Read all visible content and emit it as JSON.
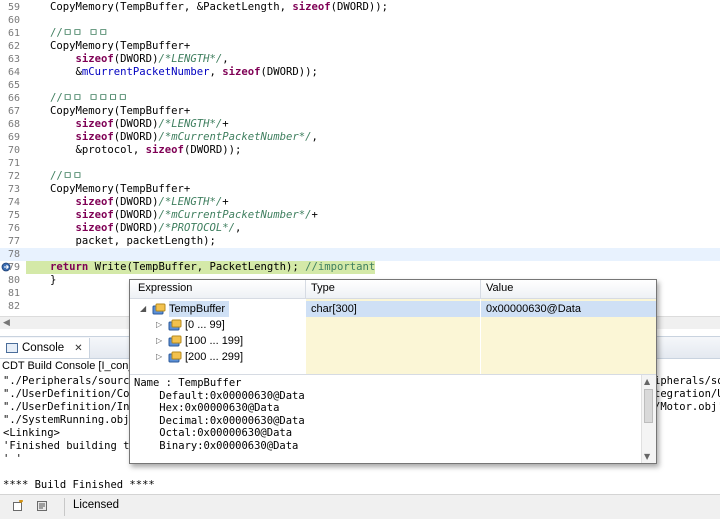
{
  "editor": {
    "lines": [
      {
        "num": "59",
        "tokens": [
          {
            "t": "CopyMemory(TempBuffer, &PacketLength, "
          },
          {
            "t": "sizeof",
            "c": "kw"
          },
          {
            "t": "(DWORD));"
          }
        ]
      },
      {
        "num": "60",
        "tokens": []
      },
      {
        "num": "61",
        "tokens": [
          {
            "t": "//ㅁㅁ ㅁㅁ",
            "c": "cm"
          }
        ]
      },
      {
        "num": "62",
        "tokens": [
          {
            "t": "CopyMemory(TempBuffer+"
          }
        ]
      },
      {
        "num": "63",
        "tokens": [
          {
            "t": "    "
          },
          {
            "t": "sizeof",
            "c": "kw"
          },
          {
            "t": "(DWORD)"
          },
          {
            "t": "/*LENGTH*/",
            "c": "cmi"
          },
          {
            "t": ","
          }
        ]
      },
      {
        "num": "64",
        "tokens": [
          {
            "t": "    &"
          },
          {
            "t": "mCurrentPacketNumber",
            "c": "mc"
          },
          {
            "t": ", "
          },
          {
            "t": "sizeof",
            "c": "kw"
          },
          {
            "t": "(DWORD));"
          }
        ]
      },
      {
        "num": "65",
        "tokens": []
      },
      {
        "num": "66",
        "tokens": [
          {
            "t": "//ㅁㅁ ㅁㅁㅁㅁ",
            "c": "cm"
          }
        ]
      },
      {
        "num": "67",
        "tokens": [
          {
            "t": "CopyMemory(TempBuffer+"
          }
        ]
      },
      {
        "num": "68",
        "tokens": [
          {
            "t": "    "
          },
          {
            "t": "sizeof",
            "c": "kw"
          },
          {
            "t": "(DWORD)"
          },
          {
            "t": "/*LENGTH*/",
            "c": "cmi"
          },
          {
            "t": "+"
          }
        ]
      },
      {
        "num": "69",
        "tokens": [
          {
            "t": "    "
          },
          {
            "t": "sizeof",
            "c": "kw"
          },
          {
            "t": "(DWORD)"
          },
          {
            "t": "/*mCurrentPacketNumber*/",
            "c": "cmi"
          },
          {
            "t": ","
          }
        ]
      },
      {
        "num": "70",
        "tokens": [
          {
            "t": "    &protocol, "
          },
          {
            "t": "sizeof",
            "c": "kw"
          },
          {
            "t": "(DWORD));"
          }
        ]
      },
      {
        "num": "71",
        "tokens": []
      },
      {
        "num": "72",
        "tokens": [
          {
            "t": "//ㅁㅁ",
            "c": "cm"
          }
        ]
      },
      {
        "num": "73",
        "tokens": [
          {
            "t": "CopyMemory(TempBuffer+"
          }
        ]
      },
      {
        "num": "74",
        "tokens": [
          {
            "t": "    "
          },
          {
            "t": "sizeof",
            "c": "kw"
          },
          {
            "t": "(DWORD)"
          },
          {
            "t": "/*LENGTH*/",
            "c": "cmi"
          },
          {
            "t": "+"
          }
        ]
      },
      {
        "num": "75",
        "tokens": [
          {
            "t": "    "
          },
          {
            "t": "sizeof",
            "c": "kw"
          },
          {
            "t": "(DWORD)"
          },
          {
            "t": "/*mCurrentPacketNumber*/",
            "c": "cmi"
          },
          {
            "t": "+"
          }
        ]
      },
      {
        "num": "76",
        "tokens": [
          {
            "t": "    "
          },
          {
            "t": "sizeof",
            "c": "kw"
          },
          {
            "t": "(DWORD)"
          },
          {
            "t": "/*PROTOCOL*/",
            "c": "cmi"
          },
          {
            "t": ","
          }
        ]
      },
      {
        "num": "77",
        "tokens": [
          {
            "t": "    packet, packetLength);"
          }
        ]
      },
      {
        "num": "78",
        "tokens": [],
        "current": true
      },
      {
        "num": "79",
        "tokens": [
          {
            "t": "return",
            "c": "kw"
          },
          {
            "t": " Write(TempBuffer, PacketLength); "
          },
          {
            "t": "//important",
            "c": "cm"
          }
        ],
        "highlight": true
      },
      {
        "num": "80",
        "tokens": [
          {
            "t": "}"
          }
        ]
      },
      {
        "num": "81",
        "tokens": []
      },
      {
        "num": "82",
        "tokens": []
      }
    ]
  },
  "console": {
    "tab_label": "Console",
    "close_glyph": "✕",
    "subtitle": "CDT Build Console [I_con_c",
    "lines": [
      "\"./Peripherals/source",
      "\"./UserDefinition/Con",
      "\"./UserDefinition/Int",
      "\"./SystemRunning.obj\"",
      "<Linking>",
      "'Finished building ta",
      "' '",
      "",
      "**** Build Finished ****"
    ],
    "right_lines": [
      "ipherals/so",
      "tegration/U",
      "/Motor.obj'"
    ]
  },
  "statusbar": {
    "label": "Licensed"
  },
  "expression_popup": {
    "headers": {
      "expression": "Expression",
      "type": "Type",
      "value": "Value"
    },
    "rows": [
      {
        "name": "TempBuffer",
        "type": "char[300]",
        "value": "0x00000630@Data",
        "expanded": true
      },
      {
        "name": "[0 ... 99]",
        "type": "",
        "value": ""
      },
      {
        "name": "[100 ... 199]",
        "type": "",
        "value": ""
      },
      {
        "name": "[200 ... 299]",
        "type": "",
        "value": ""
      }
    ],
    "detail_lines": [
      "Name : TempBuffer",
      "    Default:0x00000630@Data",
      "    Hex:0x00000630@Data",
      "    Decimal:0x00000630@Data",
      "    Octal:0x00000630@Data",
      "    Binary:0x00000630@Data"
    ]
  },
  "colors": {
    "keyword": "#7f0055",
    "comment": "#3f7f5f",
    "member": "#0000c0",
    "current_line": "#e8f2fe",
    "debug_line": "#d4e9a8",
    "tree_fill": "#fbf6d6"
  },
  "icons": {
    "breakpoint": "breakpoint-arrow-icon",
    "console": "console-icon",
    "variable": "variable-icon"
  }
}
